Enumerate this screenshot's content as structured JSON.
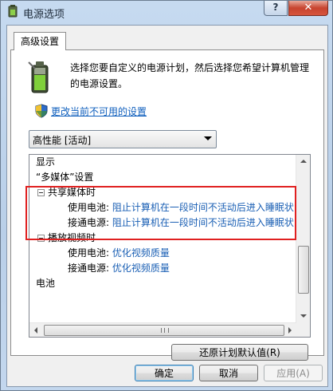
{
  "window": {
    "title": "电源选项",
    "help_label": "?",
    "close_label": "✕"
  },
  "tab": {
    "label": "高级设置"
  },
  "description": "选择您要自定义的电源计划，然后选择您希望计算机管理的电源设置。",
  "change_link": "更改当前不可用的设置",
  "plan": {
    "selected": "高性能 [活动]"
  },
  "tree": {
    "display": "显示",
    "multimedia": "“多媒体”设置",
    "media_sharing": "共享媒体时",
    "battery1_label": "使用电池:",
    "battery1_value": "阻止计算机在一段时间不活动后进入睡眠状",
    "ac1_label": "接通电源:",
    "ac1_value": "阻止计算机在一段时间不活动后进入睡眠状",
    "video_playback": "播放视频时",
    "battery2_label": "使用电池:",
    "battery2_value": "优化视频质量",
    "ac2_label": "接通电源:",
    "ac2_value": "优化视频质量",
    "battery": "电池"
  },
  "buttons": {
    "restore": "还原计划默认值(R)",
    "ok": "确定",
    "cancel": "取消",
    "apply": "应用(A)"
  },
  "colors": {
    "link": "#0f5fbd",
    "value": "#1a5fb4",
    "highlight": "#e02020"
  }
}
